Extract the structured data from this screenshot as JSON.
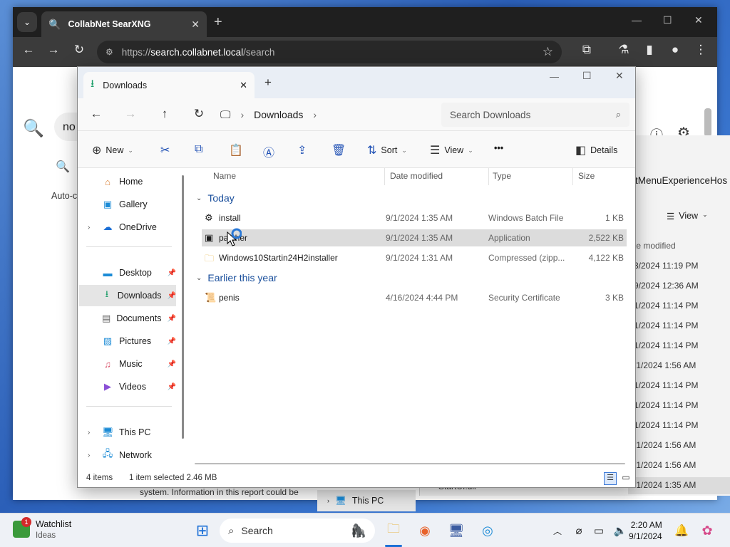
{
  "browser": {
    "tab_title": "CollabNet SearXNG",
    "url_scheme": "https://",
    "url_domain": "search.collabnet.local",
    "url_path": "/search",
    "search_value": "no",
    "autocomplete_label": "Auto-c",
    "bottom_text": "system.  Information in this report could be"
  },
  "explorer": {
    "tab_title": "Downloads",
    "breadcrumb": "Downloads",
    "search_placeholder": "Search Downloads",
    "commands": {
      "new": "New",
      "sort": "Sort",
      "view": "View",
      "more": "•••",
      "details": "Details"
    },
    "nav": {
      "home": "Home",
      "gallery": "Gallery",
      "onedrive": "OneDrive",
      "desktop": "Desktop",
      "downloads": "Downloads",
      "documents": "Documents",
      "pictures": "Pictures",
      "music": "Music",
      "videos": "Videos",
      "thispc": "This PC",
      "network": "Network"
    },
    "columns": {
      "name": "Name",
      "date": "Date modified",
      "type": "Type",
      "size": "Size"
    },
    "groups": {
      "today": "Today",
      "earlier": "Earlier this year"
    },
    "files": [
      {
        "name": "install",
        "date": "9/1/2024 1:35 AM",
        "type": "Windows Batch File",
        "size": "1 KB"
      },
      {
        "name": "patcher",
        "date": "9/1/2024 1:35 AM",
        "type": "Application",
        "size": "2,522 KB"
      },
      {
        "name": "Windows10Startin24H2installer",
        "date": "9/1/2024 1:31 AM",
        "type": "Compressed (zipp...",
        "size": "4,122 KB"
      },
      {
        "name": "penis",
        "date": "4/16/2024 4:44 PM",
        "type": "Security Certificate",
        "size": "3 KB"
      }
    ],
    "status": {
      "count": "4 items",
      "selected": "1 item selected  2.46 MB"
    }
  },
  "explorer2": {
    "title": "tMenuExperienceHos",
    "view": "View",
    "col": "te modified",
    "dates": [
      "3/2024 11:19 PM",
      "9/2024 12:36 AM",
      "1/2024 11:14 PM",
      "1/2024 11:14 PM",
      "1/2024 11:14 PM",
      "/1/2024 1:56 AM",
      "1/2024 11:14 PM",
      "1/2024 11:14 PM",
      "1/2024 11:14 PM",
      "/1/2024 1:56 AM",
      "/1/2024 1:56 AM",
      "/1/2024 1:35 AM"
    ],
    "file": "StartUI.dll",
    "nav_thispc": "This PC"
  },
  "taskbar": {
    "widget_title": "Watchlist",
    "widget_sub": "Ideas",
    "badge": "1",
    "search": "Search",
    "time": "2:20 AM",
    "date": "9/1/2024"
  }
}
